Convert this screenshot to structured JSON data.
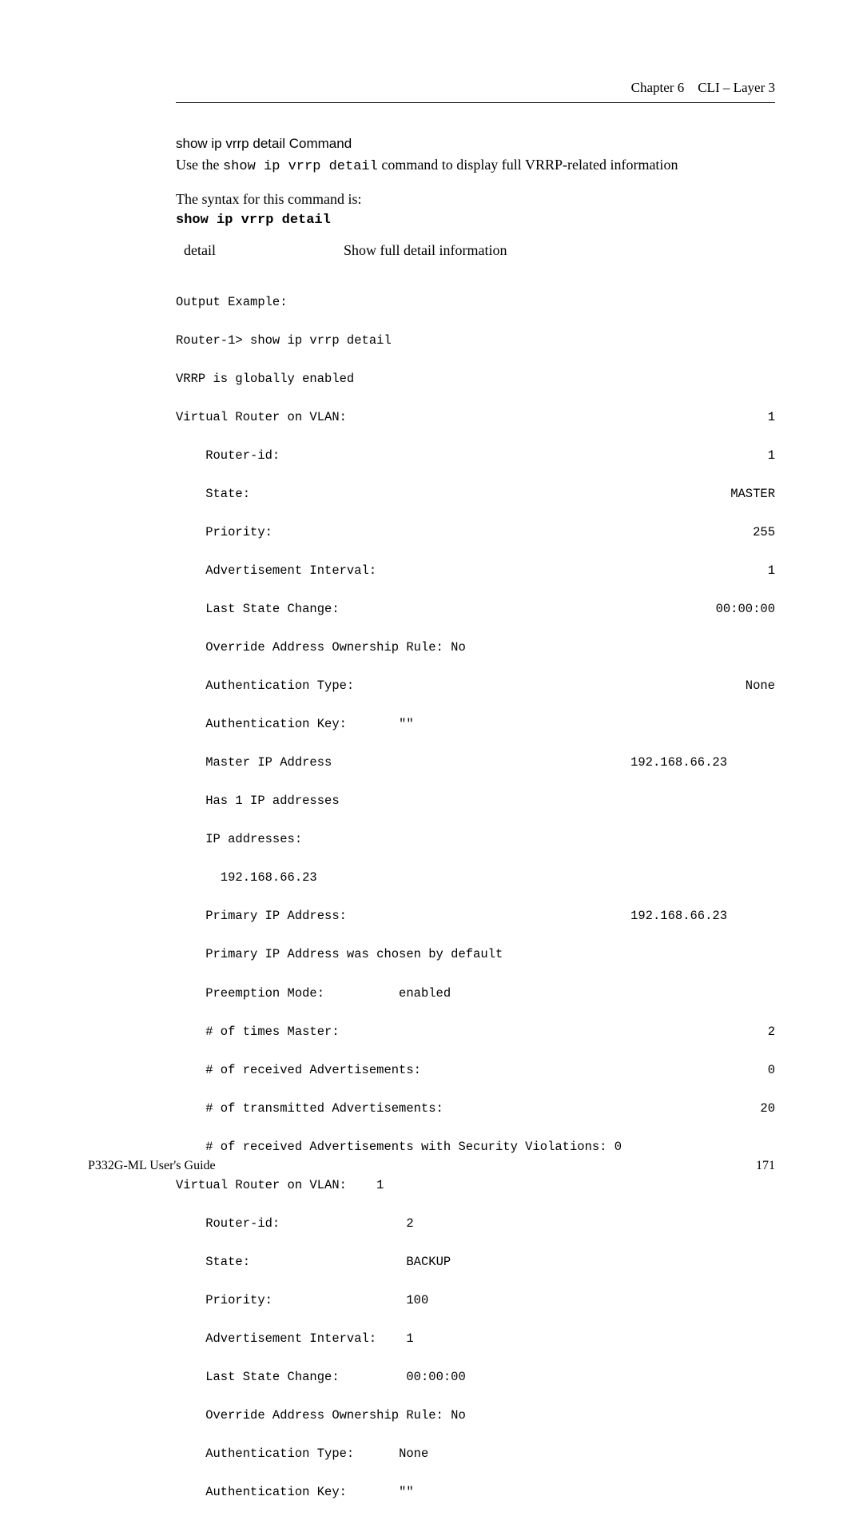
{
  "header": {
    "chapter": "Chapter 6",
    "title": "CLI – Layer 3"
  },
  "section": {
    "heading": "show ip vrrp detail Command",
    "description_pre": "Use the ",
    "description_cmd": "show ip vrrp detail",
    "description_post": " command to display full VRRP-related information",
    "syntax_label": "The syntax for this command is:",
    "syntax_cmd": "show ip vrrp detail",
    "param_name": "detail",
    "param_desc": "Show full detail information"
  },
  "output": {
    "heading": "Output Example:",
    "line_prompt": "Router-1> show ip vrrp detail",
    "line_enabled": "VRRP is globally enabled",
    "vr1_label": "Virtual Router on VLAN:",
    "vr1_val": "1",
    "router_id1_label": "    Router-id:",
    "router_id1_val": "1",
    "state1_label": "    State:",
    "state1_val": "MASTER",
    "priority1_label": "    Priority:",
    "priority1_val": "255",
    "adv1_label": "    Advertisement Interval:",
    "adv1_val": "1",
    "lsc1_label": "    Last State Change:",
    "lsc1_val": "00:00:00",
    "override1": "    Override Address Ownership Rule: No",
    "auth_type1_label": "    Authentication Type:",
    "auth_type1_val": "None",
    "auth_key1_label": "    Authentication Key:",
    "auth_key1_val": "\"\"",
    "master_ip_label": "    Master IP Address",
    "master_ip_val": "192.168.66.23",
    "has_ips": "    Has 1 IP addresses",
    "ips_label": "    IP addresses:",
    "ips_val": "      192.168.66.23",
    "primary_ip_label": "    Primary IP Address:",
    "primary_ip_val": "192.168.66.23",
    "primary_chosen": "    Primary IP Address was chosen by default",
    "preempt_label": "    Preemption Mode:",
    "preempt_val": "enabled",
    "times_master_label": "    # of times Master:",
    "times_master_val": "2",
    "recv_adv_label": "    # of received Advertisements:",
    "recv_adv_val": "0",
    "trans_adv_label": "    # of transmitted Advertisements:",
    "trans_adv_val": "20",
    "sec_viol": "    # of received Advertisements with Security Violations: 0",
    "vr2_label": "Virtual Router on VLAN:",
    "vr2_val": "1",
    "router_id2_label": "    Router-id:",
    "router_id2_val": "2",
    "state2_label": "    State:",
    "state2_val": "BACKUP",
    "priority2_label": "    Priority:",
    "priority2_val": "100",
    "adv2_label": "    Advertisement Interval:",
    "adv2_val": "1",
    "lsc2_label": "    Last State Change:",
    "lsc2_val": "00:00:00",
    "override2": "    Override Address Ownership Rule: No",
    "auth_type2_label": "    Authentication Type:",
    "auth_type2_val": "None",
    "auth_key2_label": "    Authentication Key:",
    "auth_key2_val": "\"\""
  },
  "footer": {
    "left": "P332G-ML User's Guide",
    "right": "171"
  }
}
